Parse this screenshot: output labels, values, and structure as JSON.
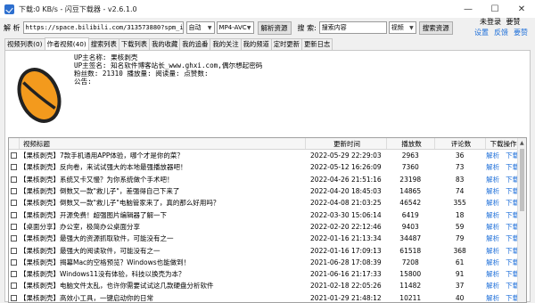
{
  "window": {
    "title": "下载:0 KB/s - 闪豆下载器 - v2.6.1.0",
    "minimize": "—",
    "maximize": "☐",
    "close": "✕"
  },
  "toolbar": {
    "parse_label": "解 析",
    "url_value": "https://space.bilibili.com/313573880?spm_id_from=333.",
    "mode_select": "自动",
    "format_select": "MP4-AVC",
    "parse_button": "解析资源",
    "search_label": "搜 索:",
    "search_placeholder": "搜索内容",
    "search_type": "视频",
    "search_button": "搜索资源"
  },
  "user": {
    "status": "未登录",
    "vip": "要赞",
    "settings": "设置",
    "feedback": "反馈",
    "login": "要赞"
  },
  "tabs": [
    {
      "label": "视频列表(0)"
    },
    {
      "label": "作者视频(40)"
    },
    {
      "label": "搜索列表"
    },
    {
      "label": "下载列表"
    },
    {
      "label": "我的收藏"
    },
    {
      "label": "我的追番"
    },
    {
      "label": "我的关注"
    },
    {
      "label": "我的频道"
    },
    {
      "label": "定时更新"
    },
    {
      "label": "更新日志"
    }
  ],
  "uploader": {
    "name": "UP主名称: 果核剥壳",
    "sign": "UP主签名: 知名软件博客站长_www.ghxi.com,偶尔想起密码",
    "stats": "粉丝数: 21310  播放量:   阅读量:   点赞数:",
    "notice": "公告:"
  },
  "table": {
    "headers": {
      "title": "视频标题",
      "time": "更新时间",
      "plays": "播放数",
      "comments": "评论数",
      "actions": "下载操作"
    },
    "action_labels": [
      "解析",
      "下载",
      "关注"
    ],
    "rows": [
      {
        "title": "【果核剥壳】7款手机通用APP体验，哪个才是你的菜？",
        "time": "2022-05-29 22:29:03",
        "plays": "2963",
        "comments": "36"
      },
      {
        "title": "【果核剥壳】反向卷，来试试强大的本地最强播放器吧！",
        "time": "2022-05-12 16:26:09",
        "plays": "7360",
        "comments": "73"
      },
      {
        "title": "【果核剥壳】系统又卡又慢？为你系统做个手术吧！",
        "time": "2022-04-26 21:51:16",
        "plays": "23198",
        "comments": "83"
      },
      {
        "title": "【果核剥壳】倒数又一款\"救儿子\"，差强得自己下来了",
        "time": "2022-04-20 18:45:03",
        "plays": "14865",
        "comments": "74"
      },
      {
        "title": "【果核剥壳】倒数又一款\"救儿子\"电脑管家来了，真的那么好用吗？",
        "time": "2022-04-08 21:03:25",
        "plays": "46542",
        "comments": "355"
      },
      {
        "title": "【果核剥壳】开源免费！超强图片编辑器了解一下",
        "time": "2022-03-30 15:06:14",
        "plays": "6419",
        "comments": "18"
      },
      {
        "title": "【桌面分享】办公室，极简办公桌面分享",
        "time": "2022-02-20 22:12:46",
        "plays": "9403",
        "comments": "59"
      },
      {
        "title": "【果核剥壳】最强大的资源抓取软件，可能没有之一",
        "time": "2022-01-16 21:13:34",
        "plays": "34487",
        "comments": "79"
      },
      {
        "title": "【果核剥壳】最强大的阅读软件，可能没有之一",
        "time": "2022-01-16 17:09:13",
        "plays": "61518",
        "comments": "368"
      },
      {
        "title": "【果核剥壳】揭幕Mac的空格预览？Windows也能做到！",
        "time": "2021-06-28 17:08:39",
        "plays": "7208",
        "comments": "61"
      },
      {
        "title": "【果核剥壳】Windows11没有体验，科技以换壳为本？",
        "time": "2021-06-16 21:17:33",
        "plays": "15800",
        "comments": "91"
      },
      {
        "title": "【果核剥壳】电脑文件太乱，也许你需要试试这几款硬盘分析软件",
        "time": "2021-02-18 22:05:26",
        "plays": "11482",
        "comments": "37"
      },
      {
        "title": "【果核剥壳】高效小工具，一键启动你的日常",
        "time": "2021-01-29 21:48:12",
        "plays": "10211",
        "comments": "40"
      }
    ]
  }
}
